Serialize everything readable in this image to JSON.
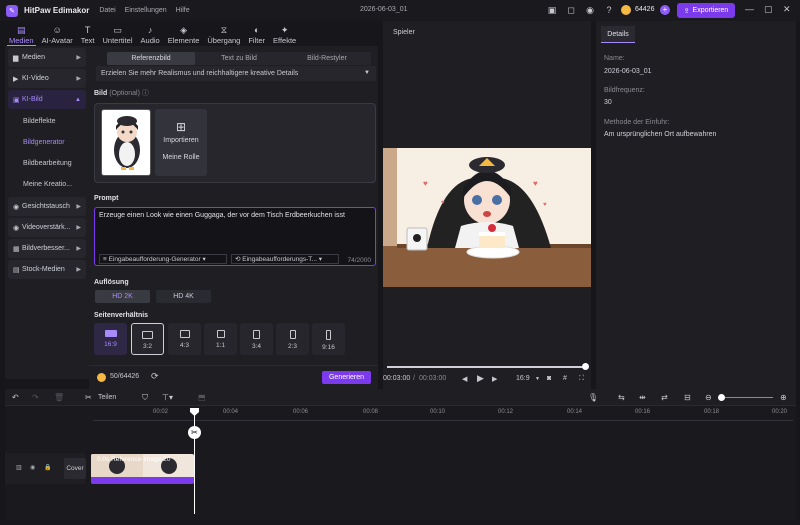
{
  "titlebar": {
    "app_name": "HitPaw Edimakor",
    "menu": [
      "Datei",
      "Einstellungen",
      "Hilfe"
    ],
    "project_name": "2026-06-03_01",
    "credits": "64426",
    "export_label": "Exportieren"
  },
  "toolbar": {
    "tabs": [
      {
        "label": "Medien",
        "icon": "media-icon"
      },
      {
        "label": "AI-Avatar",
        "icon": "avatar-icon"
      },
      {
        "label": "Text",
        "icon": "text-icon"
      },
      {
        "label": "Untertitel",
        "icon": "subtitle-icon"
      },
      {
        "label": "Audio",
        "icon": "audio-icon"
      },
      {
        "label": "Elemente",
        "icon": "elements-icon"
      },
      {
        "label": "Übergang",
        "icon": "transition-icon"
      },
      {
        "label": "Filter",
        "icon": "filter-icon"
      },
      {
        "label": "Effekte",
        "icon": "effects-icon"
      }
    ]
  },
  "sidebar": {
    "items": [
      {
        "label": "Medien"
      },
      {
        "label": "KI-Video"
      },
      {
        "label": "KI-Bild"
      },
      {
        "label": "Gesichtstausch"
      },
      {
        "label": "Videoverstärk..."
      },
      {
        "label": "Bildverbesser..."
      },
      {
        "label": "Stock-Medien"
      }
    ],
    "subitems": [
      {
        "label": "Bildeffekte"
      },
      {
        "label": "Bildgenerator"
      },
      {
        "label": "Bildbearbeitung"
      },
      {
        "label": "Meine Kreatio..."
      }
    ]
  },
  "ai_panel": {
    "tabs": [
      "Referenzbild",
      "Text zu Bild",
      "Bild-Restyler"
    ],
    "info_text": "Erzielen Sie mehr Realismus und reichhaltigere kreative Details",
    "image_label": "Bild",
    "image_optional": "(Optional)",
    "import_label": "Importieren",
    "my_role_label": "Meine Rolle",
    "prompt_label": "Prompt",
    "prompt_text": "Erzeuge einen Look wie einen Guggaga, der vor dem Tisch Erdbeerkuchen isst",
    "prompt_generator": "Eingabeaufforderung-Generator",
    "prompt_template": "Eingabeaufforderungs-T...",
    "char_count": "74/2000",
    "resolution_label": "Auflösung",
    "resolutions": [
      "HD 2K",
      "HD 4K"
    ],
    "aspect_label": "Seitenverhältnis",
    "aspects": [
      "16:9",
      "3:2",
      "4:3",
      "1:1",
      "3:4",
      "2:3",
      "9:16"
    ],
    "cost": "50/64426",
    "generate_label": "Generieren"
  },
  "player": {
    "title": "Spieler",
    "time_current": "00:03:00",
    "time_total": "00:03:00",
    "ratio": "16:9",
    "progress": 1.0
  },
  "details": {
    "tab": "Details",
    "name_label": "Name:",
    "name_value": "2026-06-03_01",
    "fps_label": "Bildfrequenz:",
    "fps_value": "30",
    "import_label": "Methode der Einfuhr:",
    "import_value": "Am ursprünglichen Ort aufbewahren"
  },
  "timeline": {
    "split_label": "Teilen",
    "ruler": [
      "00:02",
      "00:04",
      "00:06",
      "00:08",
      "00:10",
      "00:12",
      "00:14",
      "00:16",
      "00:18",
      "00:20"
    ],
    "cover_label": "Cover",
    "clip_label": "0.0s Reference-Image 20"
  },
  "colors": {
    "accent": "#7c3aed",
    "accent_light": "#a78bfa",
    "background": "#17171b",
    "panel": "#1e1e23"
  }
}
